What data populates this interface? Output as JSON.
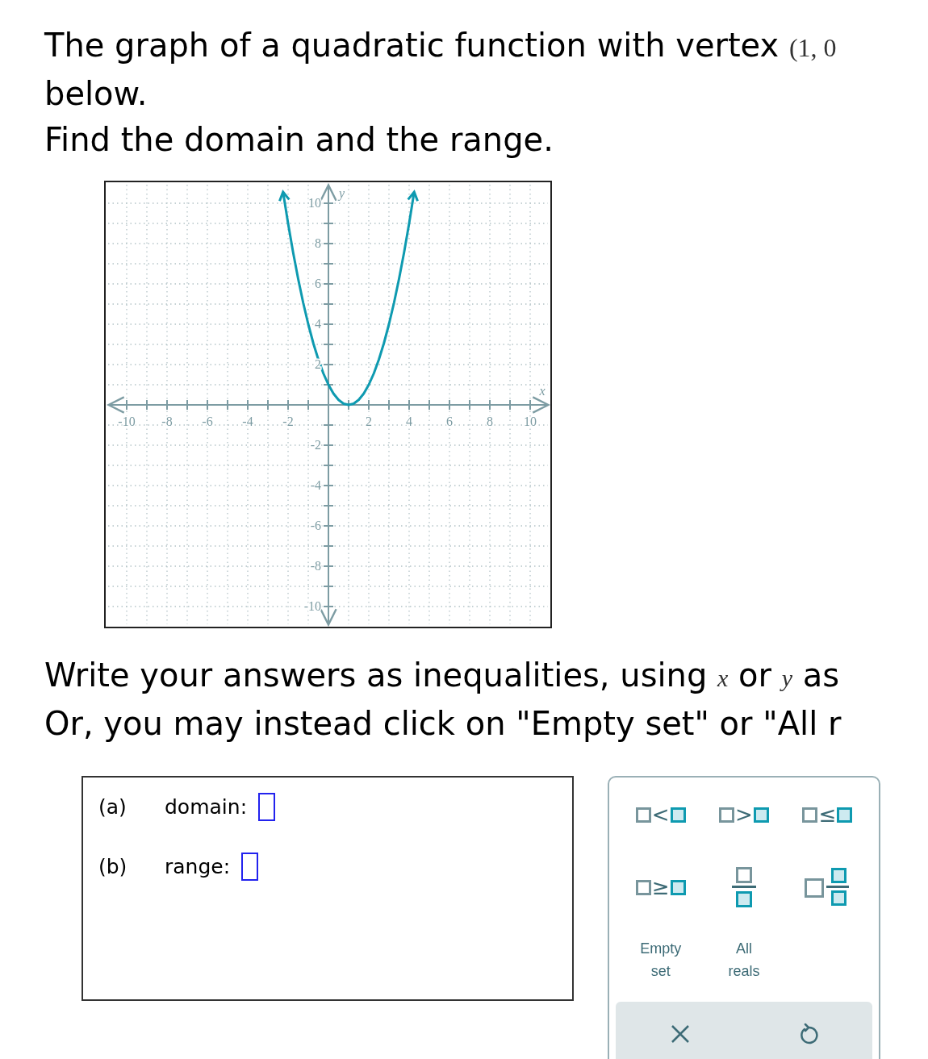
{
  "question": {
    "line_1": {
      "text": "The graph of a quadratic function with vertex ",
      "math": "(1, 0"
    },
    "line_2": "below.",
    "line_3": "Find the domain and the range."
  },
  "graph": {
    "chart_data": {
      "type": "line",
      "grid": true,
      "xlabel": "x",
      "ylabel": "y",
      "xlim": [
        -11,
        11
      ],
      "ylim": [
        -11,
        11
      ],
      "xticks": [
        -10,
        -8,
        -6,
        -4,
        -2,
        2,
        4,
        6,
        8,
        10
      ],
      "yticks": [
        -10,
        -8,
        -6,
        -4,
        -2,
        2,
        4,
        6,
        8,
        10
      ],
      "x": [
        -2.25,
        -2,
        -1.75,
        -1.5,
        -1.25,
        -1,
        -0.75,
        -0.5,
        -0.25,
        0,
        0.25,
        0.5,
        0.75,
        1,
        1.25,
        1.5,
        1.75,
        2,
        2.25,
        2.5,
        2.75,
        3,
        3.25,
        3.5,
        3.75,
        4,
        4.25
      ],
      "series": [
        {
          "color": "#0e9ab0",
          "values": [
            10.56,
            9,
            7.56,
            6.25,
            5.06,
            4,
            3.06,
            2.25,
            1.56,
            1,
            0.56,
            0.25,
            0.06,
            0,
            0.06,
            0.25,
            0.56,
            1,
            1.56,
            2.25,
            3.06,
            4,
            5.06,
            6.25,
            7.56,
            9,
            10.56
          ]
        }
      ]
    }
  },
  "instructions": [
    {
      "parts": [
        {
          "kind": "text",
          "text": "Write your answers as inequalities, using "
        },
        {
          "kind": "math",
          "text": "x"
        },
        {
          "kind": "text",
          "text": " or "
        },
        {
          "kind": "math",
          "text": "y"
        },
        {
          "kind": "text",
          "text": " as"
        }
      ]
    },
    {
      "parts": [
        {
          "kind": "text",
          "text": "Or, you may instead click on \"Empty set\" or \"All r"
        }
      ]
    }
  ],
  "answers": [
    {
      "letter": "(a)",
      "label": "domain:"
    },
    {
      "letter": "(b)",
      "label": "range:"
    }
  ],
  "keypad": {
    "keys": [
      {
        "kind": "relation",
        "symbol": "<"
      },
      {
        "kind": "relation",
        "symbol": ">"
      },
      {
        "kind": "relation",
        "symbol": "≤"
      },
      {
        "kind": "relation",
        "symbol": "≥"
      },
      {
        "kind": "fraction"
      },
      {
        "kind": "mixed-number"
      },
      {
        "kind": "text",
        "lines": [
          "Empty",
          "set"
        ]
      },
      {
        "kind": "text",
        "lines": [
          "All",
          "reals"
        ]
      }
    ],
    "actions": [
      {
        "kind": "clear"
      },
      {
        "kind": "undo"
      }
    ]
  }
}
